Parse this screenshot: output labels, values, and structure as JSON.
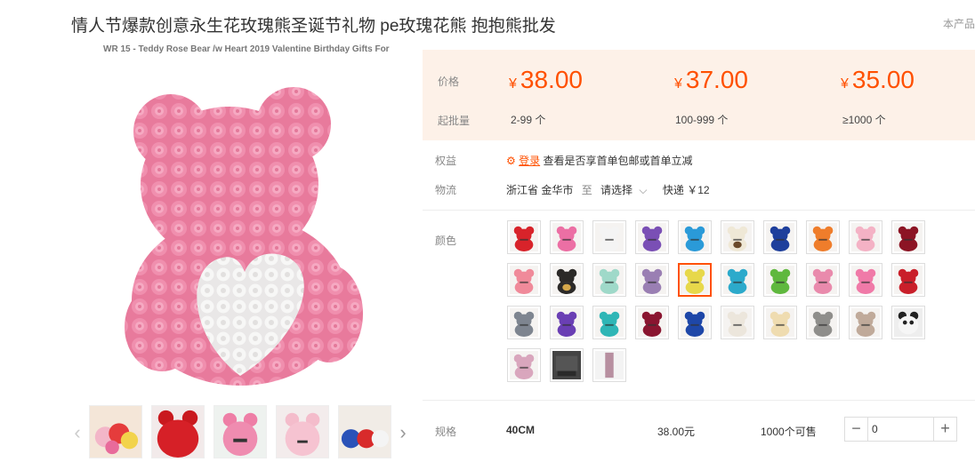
{
  "product": {
    "title": "情人节爆款创意永生花玫瑰熊圣诞节礼物 pe玫瑰花熊 抱抱熊批发",
    "page_hint": "本产品",
    "image_caption": "WR 15 - Teddy Rose Bear /w Heart 2019 Valentine Birthday Gifts For"
  },
  "pricing": {
    "price_label": "价格",
    "qty_label": "起批量",
    "currency": "¥",
    "tiers": [
      {
        "price": "38.00",
        "qty": "2-99 个"
      },
      {
        "price": "37.00",
        "qty": "100-999 个"
      },
      {
        "price": "35.00",
        "qty": "≥1000 个"
      }
    ]
  },
  "benefits": {
    "label": "权益",
    "login_link": "登录",
    "text": "查看是否享首单包邮或首单立减"
  },
  "logistics": {
    "label": "物流",
    "origin": "浙江省 金华市",
    "to": "至",
    "destination": "请选择",
    "shipping": "快递 ￥12"
  },
  "colors": {
    "label": "颜色",
    "selected_index": 14
  },
  "spec": {
    "label": "规格",
    "size": "40CM",
    "price": "38.00元",
    "stock": "1000个可售",
    "quantity": "0"
  },
  "palette": {
    "accent": "#ff5000",
    "price_bg": "#fdf1e8"
  }
}
